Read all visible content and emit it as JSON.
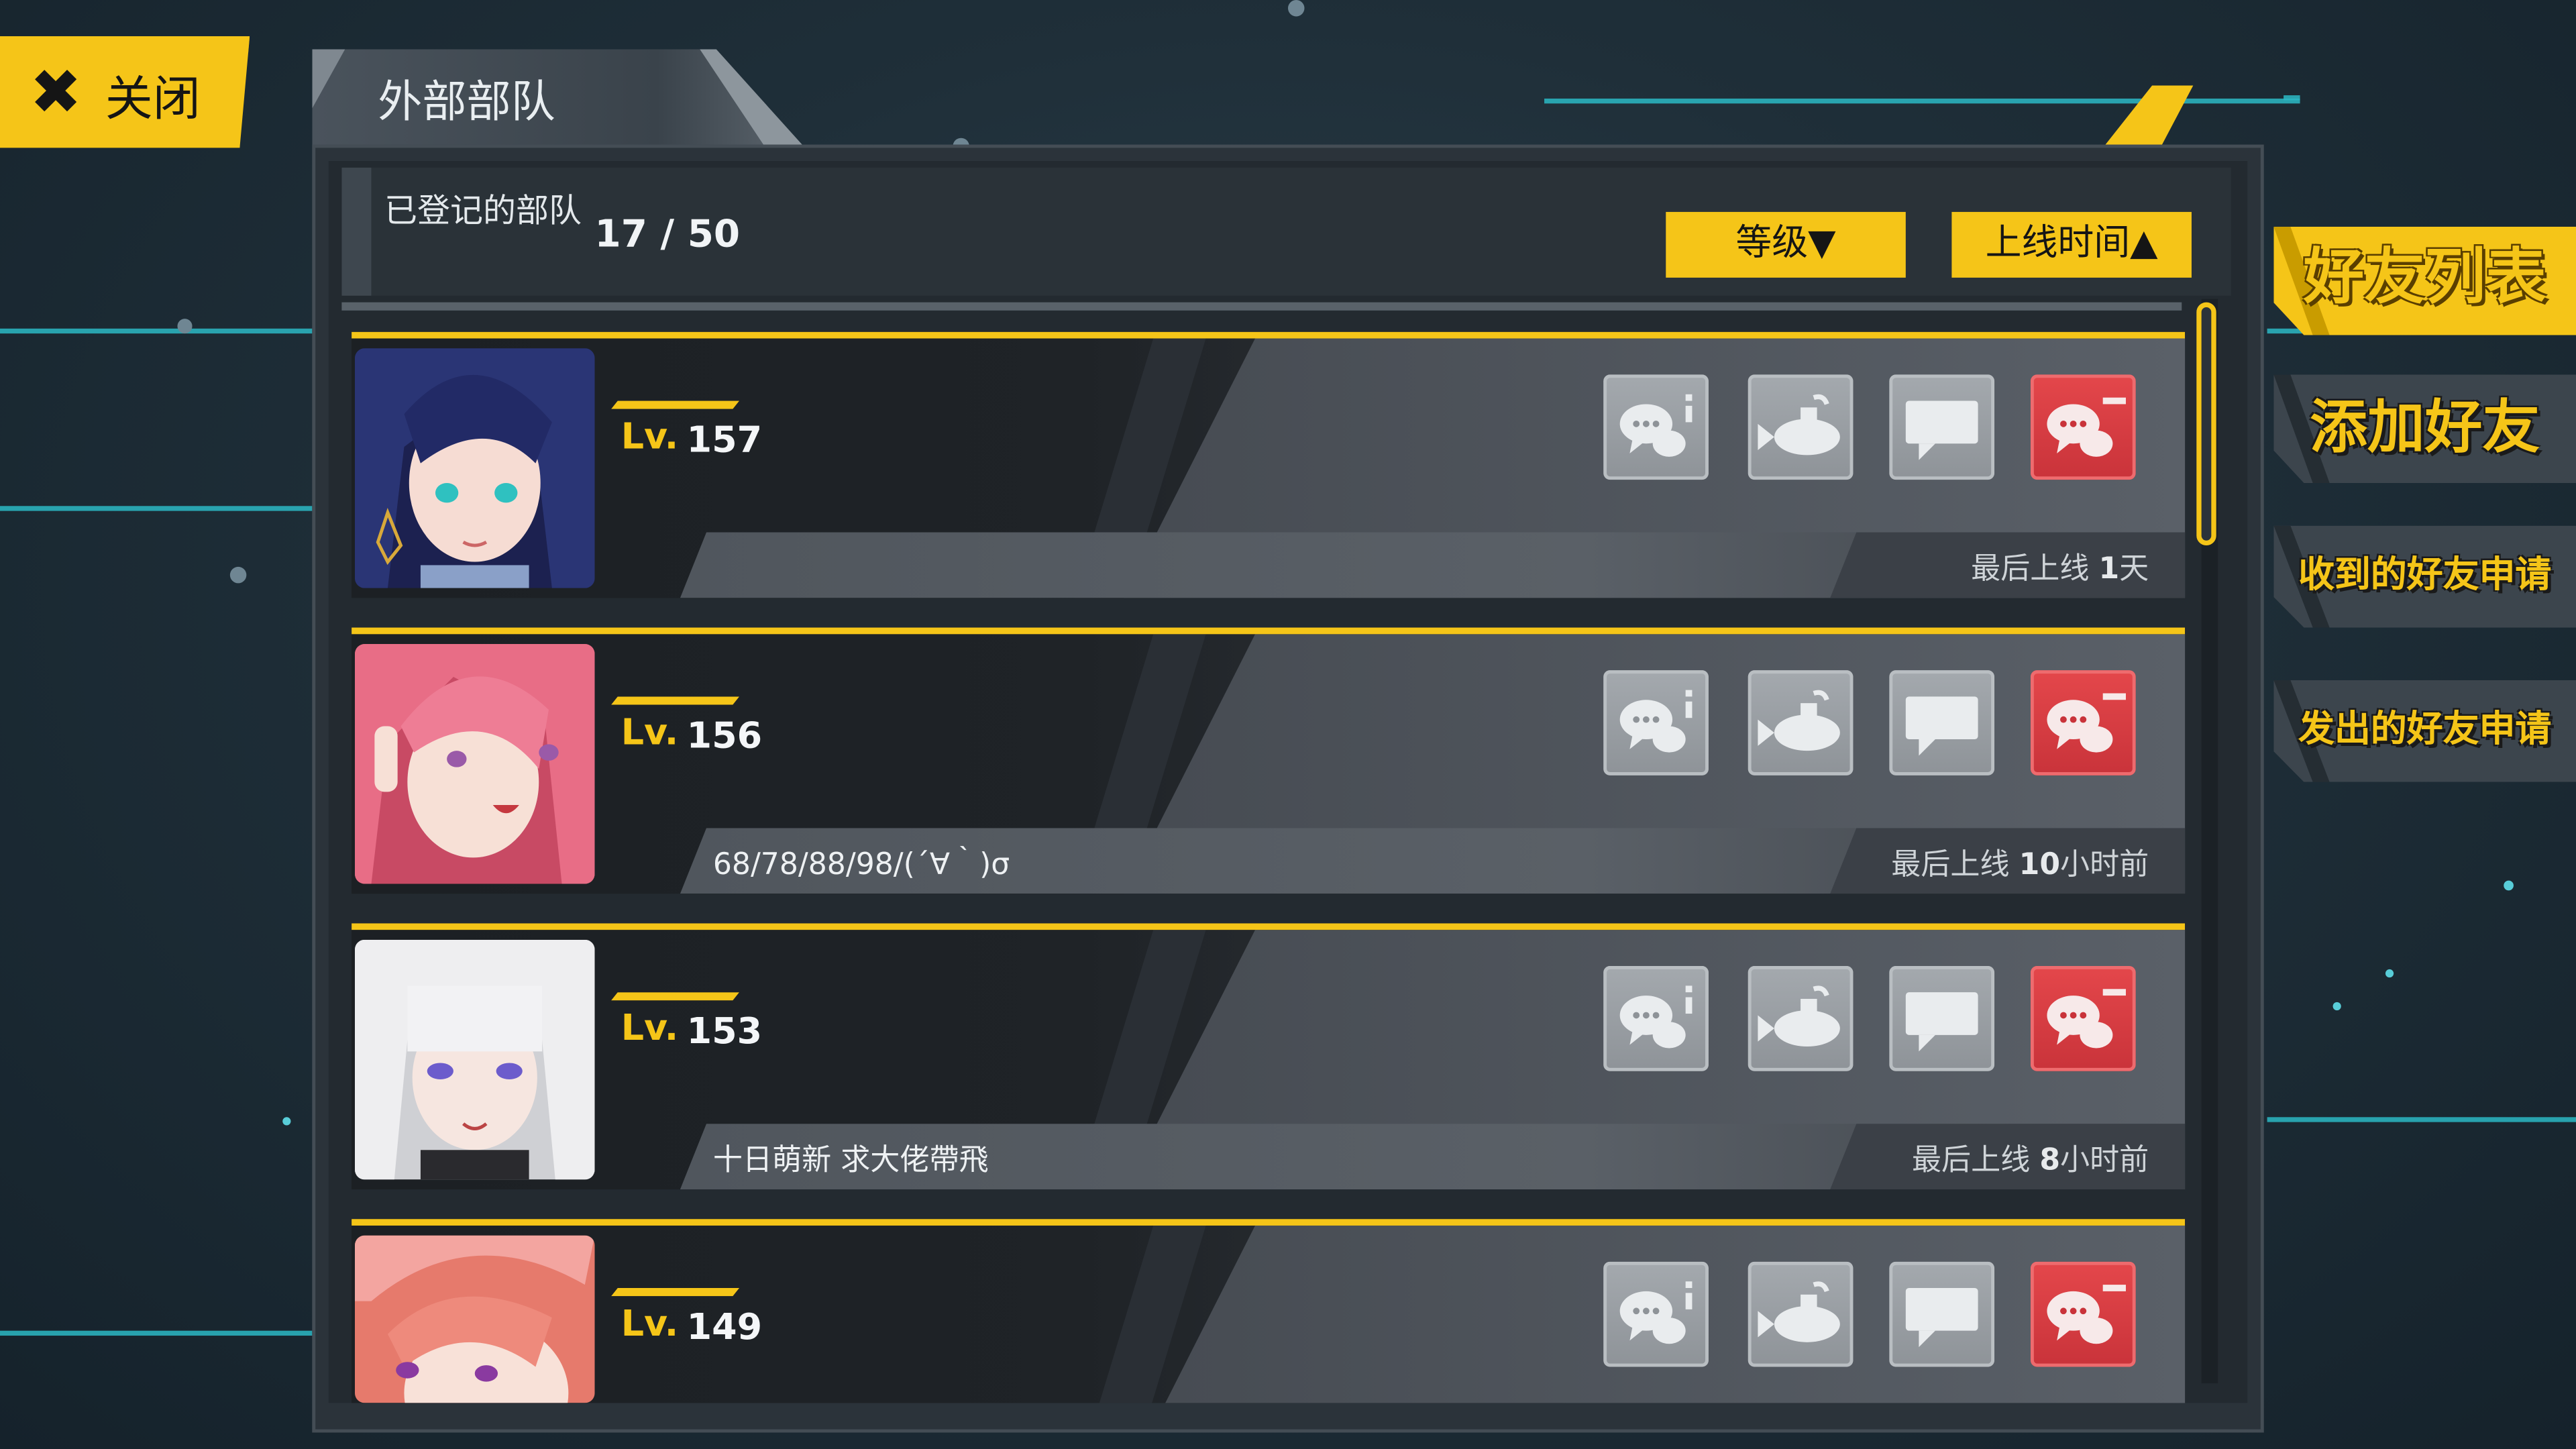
{
  "close_button": {
    "icon": "close-x-icon",
    "label": "关闭"
  },
  "panel": {
    "title": "外部部队",
    "registered_label": "已登记的部队",
    "registered_count": "17 / 50",
    "sort_buttons": [
      {
        "label": "等级▼"
      },
      {
        "label": "上线时间▲"
      }
    ]
  },
  "friends": [
    {
      "level_prefix": "Lv.",
      "level": "157",
      "message": "",
      "last_online_label": "最后上线",
      "last_online_value": "1",
      "last_online_unit": "天",
      "avatar_hair_color": "#27336b"
    },
    {
      "level_prefix": "Lv.",
      "level": "156",
      "message": "68/78/88/98/(´∀｀)σ",
      "last_online_label": "最后上线",
      "last_online_value": "10",
      "last_online_unit": "小时前",
      "avatar_hair_color": "#e36a82"
    },
    {
      "level_prefix": "Lv.",
      "level": "153",
      "message": "十日萌新 求大佬帶飛",
      "last_online_label": "最后上线",
      "last_online_value": "8",
      "last_online_unit": "小时前",
      "avatar_hair_color": "#e2e2e4"
    },
    {
      "level_prefix": "Lv.",
      "level": "149",
      "message": "",
      "last_online_label": "",
      "last_online_value": "",
      "last_online_unit": "",
      "avatar_hair_color": "#ee8a7c"
    }
  ],
  "row_actions": [
    {
      "name": "chat-info-icon",
      "color": "gray"
    },
    {
      "name": "submarine-support-icon",
      "color": "gray"
    },
    {
      "name": "message-icon",
      "color": "gray"
    },
    {
      "name": "remove-friend-icon",
      "color": "red"
    }
  ],
  "side_tabs": [
    {
      "label": "好友列表",
      "active": true
    },
    {
      "label": "添加好友",
      "active": false
    },
    {
      "label": "收到的好友申请",
      "active": false
    },
    {
      "label": "发出的好友申请",
      "active": false
    }
  ],
  "colors": {
    "accent": "#f5c518",
    "danger": "#d63a3f",
    "panel": "#2b333a"
  }
}
